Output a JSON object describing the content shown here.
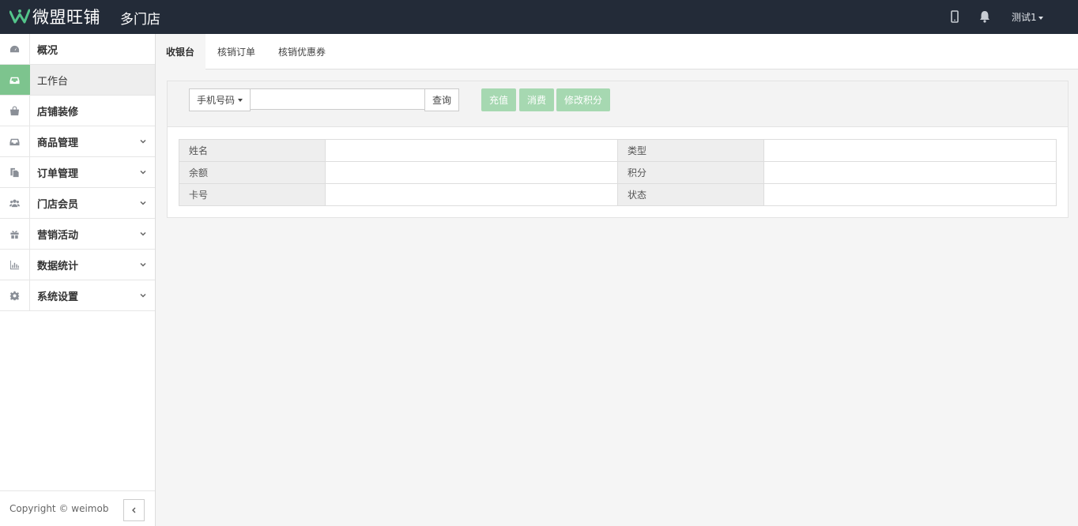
{
  "header": {
    "logo_text": "微盟旺铺",
    "store_title": "多门店",
    "user_name": "测试1"
  },
  "sidebar": {
    "items": [
      {
        "label": "概况"
      },
      {
        "label": "工作台"
      },
      {
        "label": "店铺装修"
      },
      {
        "label": "商品管理"
      },
      {
        "label": "订单管理"
      },
      {
        "label": "门店会员"
      },
      {
        "label": "营销活动"
      },
      {
        "label": "数据统计"
      },
      {
        "label": "系统设置"
      }
    ],
    "copyright": "Copyright © weimob"
  },
  "tabs": [
    {
      "label": "收银台"
    },
    {
      "label": "核销订单"
    },
    {
      "label": "核销优惠券"
    }
  ],
  "search": {
    "type_select": "手机号码",
    "input_value": "",
    "query_label": "查询"
  },
  "actions": {
    "recharge": "充值",
    "consume": "消费",
    "edit_points": "修改积分"
  },
  "member_info": {
    "rows": [
      {
        "k1": "姓名",
        "v1": "",
        "k2": "类型",
        "v2": ""
      },
      {
        "k1": "余额",
        "v1": "",
        "k2": "积分",
        "v2": ""
      },
      {
        "k1": "卡号",
        "v1": "",
        "k2": "状态",
        "v2": ""
      }
    ]
  },
  "colors": {
    "header_bg": "#232b38",
    "accent_green": "#7dc48e",
    "button_green": "#a6d8b1"
  }
}
